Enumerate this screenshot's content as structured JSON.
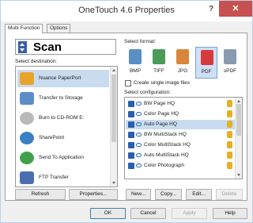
{
  "window": {
    "title": "OneTouch 4.6 Properties",
    "help_label": "?",
    "close_label": "✕"
  },
  "tabs": [
    {
      "label": "Multi Function",
      "active": true
    },
    {
      "label": "Options",
      "active": false
    }
  ],
  "scan_button": {
    "label": "Scan"
  },
  "destination": {
    "label": "Select destination:",
    "items": [
      {
        "label": "Nuance PaperPort",
        "icon": "paperport-icon",
        "selected": true,
        "color": "#e8a42a"
      },
      {
        "label": "Transfer to Storage",
        "icon": "storage-icon",
        "selected": false,
        "color": "#5b8dc9"
      },
      {
        "label": "Burn to CD-ROM  E:",
        "icon": "cd-icon",
        "selected": false,
        "color": "#b9b9b9"
      },
      {
        "label": "SharePoint",
        "icon": "sharepoint-icon",
        "selected": false,
        "color": "#3b7fc4"
      },
      {
        "label": "Send To Application",
        "icon": "send-app-icon",
        "selected": false,
        "color": "#3fa14a"
      },
      {
        "label": "FTP Transfer",
        "icon": "ftp-icon",
        "selected": false,
        "color": "#4a6fb0"
      }
    ],
    "buttons": {
      "refresh": "Refresh",
      "properties": "Properties..."
    }
  },
  "format": {
    "label": "Select format:",
    "items": [
      {
        "label": "BMP",
        "icon": "bmp-icon",
        "selected": false,
        "color": "#5a8fc5"
      },
      {
        "label": "TIFF",
        "icon": "tiff-icon",
        "selected": false,
        "color": "#4a9a5a"
      },
      {
        "label": "JPG",
        "icon": "jpg-icon",
        "selected": false,
        "color": "#d9863a"
      },
      {
        "label": "PDF",
        "icon": "pdf-icon",
        "selected": true,
        "color": "#d63b3b"
      },
      {
        "label": "sPDF",
        "icon": "spdf-icon",
        "selected": false,
        "color": "#8a9bb0"
      }
    ],
    "single_image_label": "Create single image files",
    "single_image_checked": false
  },
  "configuration": {
    "label": "Select configuration:",
    "items": [
      {
        "label": "BW Page HQ",
        "selected": false
      },
      {
        "label": "Color Page HQ",
        "selected": false
      },
      {
        "label": "Auto Page HQ",
        "selected": true
      },
      {
        "label": "BW MultiStack HQ",
        "selected": false
      },
      {
        "label": "Color MultiStack HQ",
        "selected": false
      },
      {
        "label": "Auto MultiStack HQ",
        "selected": false
      },
      {
        "label": "Color Photograph",
        "selected": false
      }
    ],
    "buttons": {
      "new": "New...",
      "copy": "Copy...",
      "edit": "Edit...",
      "delete": "Delete"
    }
  },
  "footer": {
    "ok": "OK",
    "cancel": "Cancel",
    "apply": "Apply",
    "help": "Help"
  },
  "colors": {
    "selection": "#c9dcef",
    "accent": "#3c7fb1",
    "close": "#c75050"
  }
}
